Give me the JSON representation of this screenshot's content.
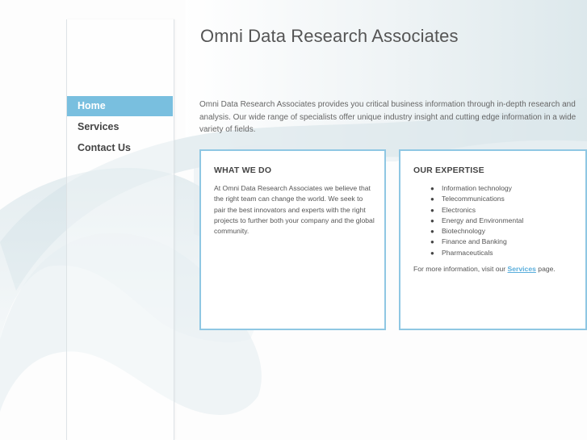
{
  "site": {
    "title": "Omni Data Research Associates"
  },
  "nav": {
    "items": [
      {
        "label": "Home",
        "active": true
      },
      {
        "label": "Services",
        "active": false
      },
      {
        "label": "Contact Us",
        "active": false
      }
    ]
  },
  "intro": {
    "text": "Omni Data Research Associates provides you critical business information through in-depth research and analysis. Our wide range of specialists offer unique industry insight and cutting edge information in a wide variety of fields."
  },
  "what_we_do": {
    "heading": "WHAT WE DO",
    "body": "At Omni Data Research Associates we believe that the right team can change the world. We seek to pair the best innovators and experts with the right projects to further both your company and the global community."
  },
  "expertise": {
    "heading": "OUR EXPERTISE",
    "items": [
      "Information technology",
      "Telecommunications",
      "Electronics",
      "Energy and Environmental",
      "Biotechnology",
      "Finance and Banking",
      "Pharmaceuticals"
    ],
    "more_prefix": "For more information, visit our ",
    "more_link": "Services",
    "more_suffix": " page."
  },
  "colors": {
    "accent": "#79bfdf",
    "card_border": "#8fc7e3",
    "link": "#5aaedc"
  }
}
